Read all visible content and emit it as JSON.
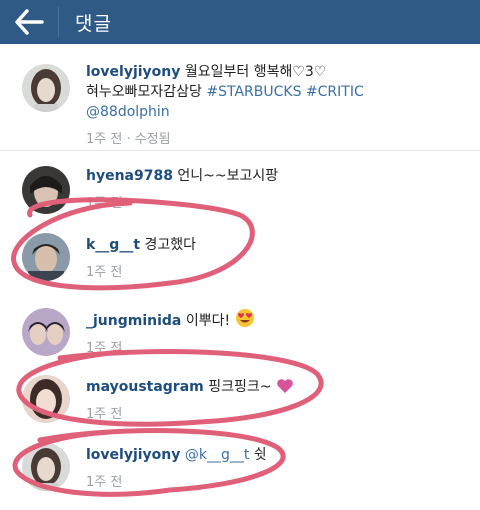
{
  "header": {
    "title": "댓글"
  },
  "comments": [
    {
      "user": "lovelyjiyony",
      "line1": "월요일부터 행복해♡3♡",
      "line2_text": "혀누오빠모자감삼당",
      "line2_tag1": "#STARBUCKS",
      "line2_tag2": "#CRITIC",
      "mention": "@88dolphin",
      "meta": "1주 전 · 수정됨"
    },
    {
      "user": "hyena9788",
      "text": "언니~~보고시팡",
      "meta": "1주 전"
    },
    {
      "user": "k__g__t",
      "text": "경고했다",
      "meta": "1주 전"
    },
    {
      "user": "_jungminida",
      "text": "이뿌다!",
      "meta": "1주 전"
    },
    {
      "user": "mayoustagram",
      "text": "핑크핑크~",
      "meta": "1주 전"
    },
    {
      "user": "lovelyjiyony",
      "text_mention": "@k__g__t",
      "text": "쉿",
      "meta": "1주 전"
    }
  ],
  "colors": {
    "header_bg": "#2f5a86",
    "username": "#1e4d7e",
    "hashtag": "#3b6fa6",
    "meta": "#9aa0a6",
    "marker": "#e0607a"
  },
  "icons": {
    "back": "arrow-left-icon",
    "emoji_face": "heart-eyes-emoji",
    "emoji_heart": "pink-heart-emoji"
  }
}
